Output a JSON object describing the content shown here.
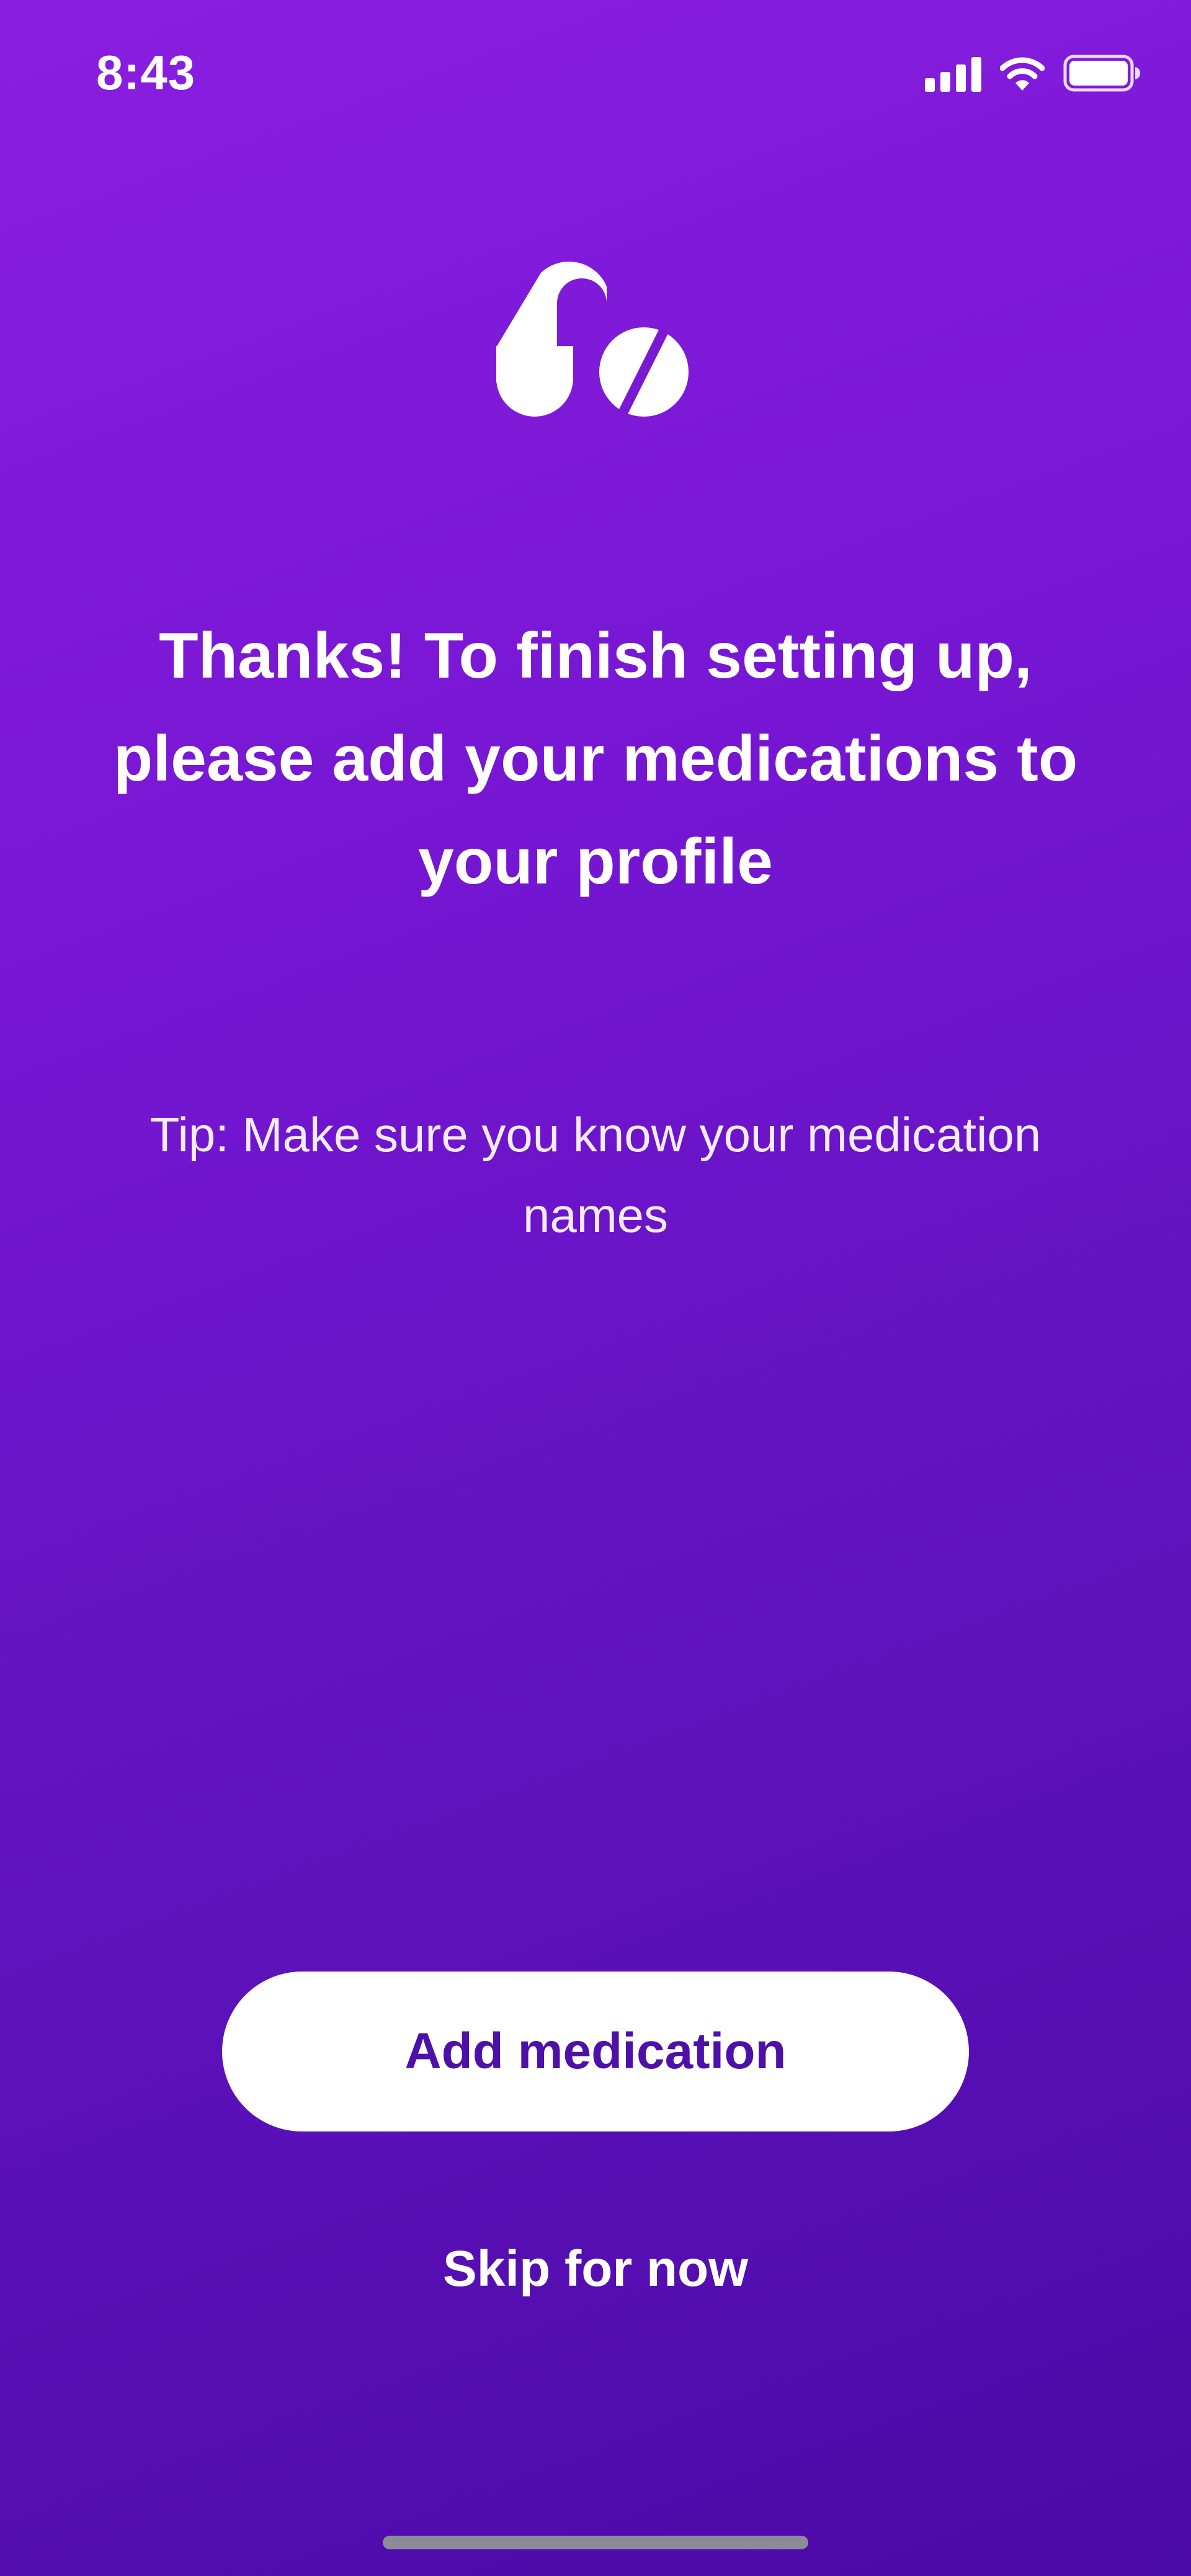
{
  "status_bar": {
    "time": "8:43",
    "icons": [
      "signal-icon",
      "wifi-icon",
      "battery-icon"
    ]
  },
  "logo": {
    "icon": "pills-logo-icon"
  },
  "content": {
    "headline": "Thanks! To finish setting up, please add your medications to your profile",
    "tip": "Tip: Make sure you know your medication names"
  },
  "actions": {
    "primary_label": "Add medication",
    "secondary_label": "Skip for now"
  },
  "colors": {
    "background_start": "#8a1ee0",
    "background_end": "#4a0aa6",
    "button_background": "#ffffff",
    "button_text": "#4d10a8"
  }
}
